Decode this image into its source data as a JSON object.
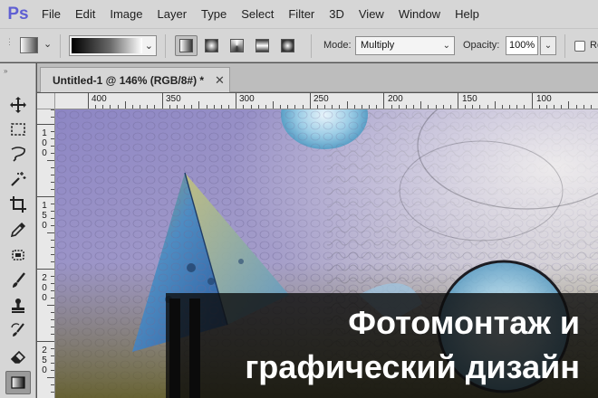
{
  "app": {
    "logo_text": "Ps",
    "menu": [
      "File",
      "Edit",
      "Image",
      "Layer",
      "Type",
      "Select",
      "Filter",
      "3D",
      "View",
      "Window",
      "Help"
    ]
  },
  "options": {
    "gradient_types": [
      "linear-gradient-icon",
      "radial-gradient-icon",
      "angle-gradient-icon",
      "reflected-gradient-icon",
      "diamond-gradient-icon"
    ],
    "mode_label": "Mode:",
    "mode_value": "Multiply",
    "opacity_label": "Opacity:",
    "opacity_value": "100%",
    "reverse_label": "Re"
  },
  "tools": [
    {
      "name": "move-tool-icon"
    },
    {
      "name": "marquee-tool-icon"
    },
    {
      "name": "lasso-tool-icon"
    },
    {
      "name": "magic-wand-tool-icon"
    },
    {
      "name": "crop-tool-icon"
    },
    {
      "name": "eyedropper-tool-icon"
    },
    {
      "name": "healing-brush-tool-icon"
    },
    {
      "name": "brush-tool-icon"
    },
    {
      "name": "clone-stamp-tool-icon"
    },
    {
      "name": "history-brush-tool-icon"
    },
    {
      "name": "eraser-tool-icon"
    },
    {
      "name": "gradient-tool-icon",
      "active": true
    }
  ],
  "document": {
    "tab_title": "Untitled-1 @ 146% (RGB/8#) *",
    "close_glyph": "✕"
  },
  "rulers": {
    "top_labels": [
      "400",
      "350",
      "300",
      "250",
      "200",
      "150",
      "100"
    ],
    "left_labels": [
      [
        "1",
        "0",
        "0"
      ],
      [
        "1",
        "5",
        "0"
      ],
      [
        "2",
        "0",
        "0"
      ],
      [
        "2",
        "5",
        "0"
      ],
      [
        "5",
        "0"
      ]
    ]
  },
  "overlay": {
    "line1": "Фотомонтаж и",
    "line2": "графический дизайн"
  },
  "colors": {
    "ui_panel": "#d6d6d6",
    "ps_logo": "#5f5fd3",
    "overlay_bg": "#0c0c0c",
    "overlay_text": "#ffffff"
  }
}
